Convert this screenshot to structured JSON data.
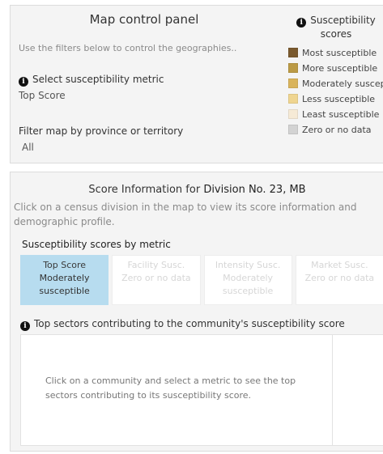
{
  "control_panel": {
    "title": "Map control panel",
    "hint": "Use the filters below to control the geographies..",
    "metric_label": "Select susceptibility metric",
    "metric_value": "Top Score",
    "province_label": "Filter map by province or territory",
    "province_value": "All",
    "info_icon_glyph": "i"
  },
  "legend": {
    "title_line1": "Susceptibility",
    "title_line2": "scores",
    "items": [
      {
        "label": "Most susceptible",
        "color": "#7a5a2e"
      },
      {
        "label": "More susceptible",
        "color": "#bb9a45"
      },
      {
        "label": "Moderately susceptible",
        "color": "#d9b45c"
      },
      {
        "label": "Less susceptible",
        "color": "#efd590"
      },
      {
        "label": "Least susceptible",
        "color": "#f6ead6"
      },
      {
        "label": "Zero or no data",
        "color": "#d3d3d3"
      }
    ]
  },
  "score_info": {
    "title_prefix": "Score Information for ",
    "division": "Division No. 23, MB",
    "hint": "Click on a census division in the map to view its score information and demographic profile.",
    "metrics_heading": "Susceptibility scores by metric",
    "cards": [
      {
        "name": "Top Score",
        "value": "Moderately susceptible"
      },
      {
        "name": "Facility Susc.",
        "value": "Zero or no data"
      },
      {
        "name": "Intensity Susc.",
        "value": "Moderately susceptible"
      },
      {
        "name": "Market Susc.",
        "value": "Zero or no data"
      }
    ],
    "sectors_heading": "Top sectors contributing to the community's susceptibility score",
    "sectors_message": "Click on a community and select a metric to see the top sectors contributing to its susceptibility score."
  },
  "colors": {
    "active_card": "#b7dcef",
    "panel_bg": "#f4f4f4"
  }
}
